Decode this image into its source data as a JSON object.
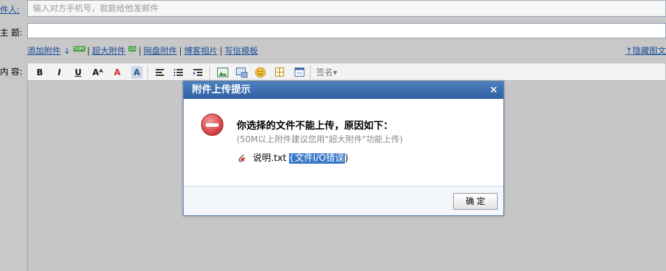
{
  "form": {
    "recipient_label": "件人:",
    "recipient_placeholder": "输入对方手机号，就能给他发邮件",
    "subject_label": "主  题:",
    "content_label": "内  容:"
  },
  "attachments": {
    "add": "添加附件",
    "add_arrow": "↓",
    "add_tag": "50M",
    "large": "超大附件",
    "large_tag": "1G",
    "netdisk": "网盘附件",
    "blog_photos": "博客相片",
    "template": "写信模板",
    "sep": "|",
    "hide_images": "↑隐藏图文"
  },
  "toolbar": {
    "bold": "B",
    "italic": "I",
    "underline": "U",
    "font_size": "Aᴬ",
    "font_color": "A",
    "bg_color": "A",
    "signature": "签名▾"
  },
  "dialog": {
    "title": "附件上传提示",
    "close": "×",
    "heading": "你选择的文件不能上传，原因如下：",
    "subtext": "(50M以上附件建议您用\"超大附件\"功能上传)",
    "filename": "说明.txt",
    "error_open": "(",
    "error_text": "文件I/O错误",
    "error_close": ")",
    "ok": "确 定"
  },
  "colors": {
    "header": "#3566a8",
    "link": "#1a4e9a",
    "highlight": "#3a78c9",
    "backdrop": "#c8c8c8"
  }
}
